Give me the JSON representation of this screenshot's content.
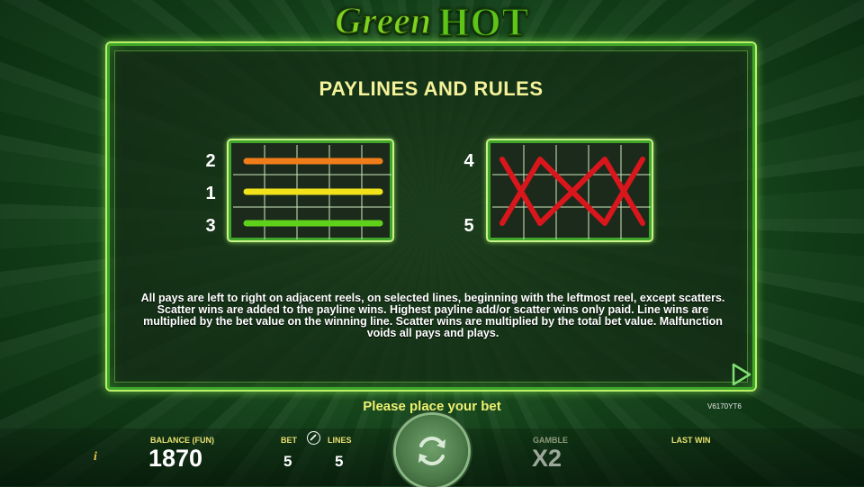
{
  "logo": {
    "word1": "Green",
    "word2": "HOT"
  },
  "panel": {
    "title": "PAYLINES AND RULES",
    "paylines_left": [
      {
        "number": "2",
        "color": "#f07d1a"
      },
      {
        "number": "1",
        "color": "#f2e21a"
      },
      {
        "number": "3",
        "color": "#5fd11a"
      }
    ],
    "paylines_right": [
      {
        "number": "4",
        "color": "#d9161c"
      },
      {
        "number": "5",
        "color": "#d9161c"
      }
    ],
    "rules_text": "All pays are left to right on adjacent reels, on selected lines, beginning with the leftmost reel, except scatters. Scatter wins are added to the payline wins. Highest payline add/or scatter wins only paid. Line wins are multiplied by the bet value on the winning line. Scatter wins are multiplied by the total bet value. Malfunction voids all pays and plays.",
    "next_icon": "play-triangle-icon"
  },
  "status_text": "Please place your bet",
  "version": "V6170YT6",
  "bottom": {
    "info_icon": "i",
    "balance_label": "BALANCE (FUN)",
    "balance_value": "1870",
    "bet_label": "BET",
    "bet_value": "5",
    "lines_label": "LINES",
    "lines_value": "5",
    "gamble_label": "GAMBLE",
    "gamble_value": "X2",
    "last_win_label": "LAST WIN",
    "last_win_value": ""
  }
}
